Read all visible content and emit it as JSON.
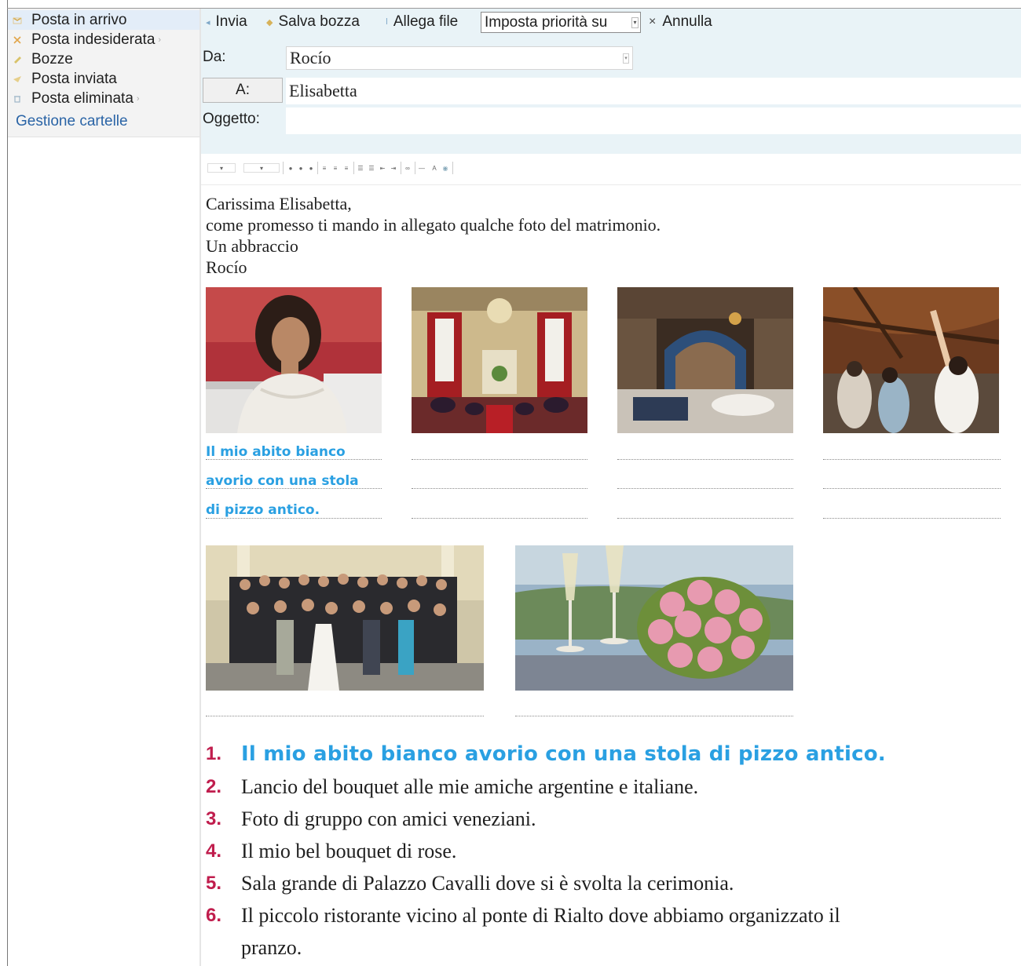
{
  "sidebar": {
    "folders": [
      {
        "label": "Posta in arrivo",
        "icon": "inbox-icon"
      },
      {
        "label": "Posta indesiderata",
        "icon": "junk-folder-icon"
      },
      {
        "label": "Bozze",
        "icon": "drafts-folder-icon"
      },
      {
        "label": "Posta inviata",
        "icon": "sent-folder-icon"
      },
      {
        "label": "Posta eliminata",
        "icon": "deleted-folder-icon"
      }
    ],
    "manage_link": "Gestione cartelle"
  },
  "toolbar": {
    "send_label": "Invia",
    "save_draft_label": "Salva bozza",
    "attach_label": "Allega file",
    "priority_value": "Imposta priorità su",
    "cancel_label": "Annulla",
    "cancel_icon": "×"
  },
  "header": {
    "from_label": "Da:",
    "from_value": "Rocío",
    "to_button": "A:",
    "to_value": "Elisabetta",
    "subject_label": "Oggetto:",
    "subject_value": ""
  },
  "message": {
    "lines": [
      "Carissima Elisabetta,",
      "come promesso ti mando in allegato qualche foto del matrimonio.",
      "Un abbraccio",
      "Rocío"
    ]
  },
  "photos": [
    {
      "subject": "bride-portrait"
    },
    {
      "subject": "ceremony-hall"
    },
    {
      "subject": "restaurant-interior"
    },
    {
      "subject": "bouquet-toss"
    },
    {
      "subject": "group-photo"
    },
    {
      "subject": "rose-bouquet-champagne"
    }
  ],
  "example_caption": [
    "Il mio abito bianco",
    "avorio con una stola",
    "di pizzo antico."
  ],
  "captions": [
    {
      "num": "1.",
      "text": "Il mio abito bianco avorio con una stola di pizzo antico."
    },
    {
      "num": "2.",
      "text": "Lancio del bouquet alle mie amiche argentine e italiane."
    },
    {
      "num": "3.",
      "text": "Foto di gruppo con amici veneziani."
    },
    {
      "num": "4.",
      "text": "Il mio bel bouquet di rose."
    },
    {
      "num": "5.",
      "text": "Sala grande di Palazzo Cavalli dove si è svolta la cerimonia."
    },
    {
      "num": "6.",
      "text": "Il piccolo ristorante vicino al ponte di Rialto dove abbiamo organizzato il pranzo."
    }
  ],
  "colors": {
    "number_accent": "#c01d4d",
    "answer_blue": "#2aa0e2",
    "link_blue": "#2a64a6",
    "header_bg": "#e9f3f7"
  }
}
